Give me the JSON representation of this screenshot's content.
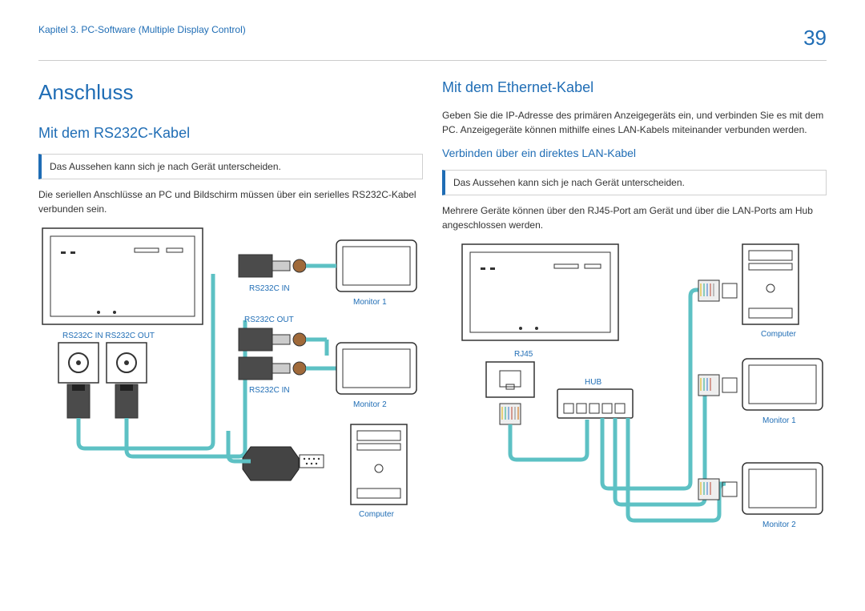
{
  "header": {
    "chapter": "Kapitel 3. PC-Software (Multiple Display Control)",
    "page": "39"
  },
  "left": {
    "title": "Anschluss",
    "h2": "Mit dem RS232C-Kabel",
    "note": "Das Aussehen kann sich je nach Gerät unterscheiden.",
    "para": "Die seriellen Anschlüsse an PC und Bildschirm müssen über ein serielles RS232C-Kabel verbunden sein.",
    "labels": {
      "rs232c_in_out": "RS232C IN RS232C OUT",
      "rs232c_in": "RS232C IN",
      "rs232c_out": "RS232C OUT",
      "monitor1": "Monitor 1",
      "monitor2": "Monitor 2",
      "computer": "Computer"
    }
  },
  "right": {
    "h2": "Mit dem Ethernet-Kabel",
    "para1": "Geben Sie die IP-Adresse des primären Anzeigegeräts ein, und verbinden Sie es mit dem PC. Anzeigegeräte können mithilfe eines LAN-Kabels miteinander verbunden werden.",
    "h3": "Verbinden über ein direktes LAN-Kabel",
    "note": "Das Aussehen kann sich je nach Gerät unterscheiden.",
    "para2": "Mehrere Geräte können über den RJ45-Port am Gerät und über die LAN-Ports am Hub angeschlossen werden.",
    "labels": {
      "rj45": "RJ45",
      "hub": "HUB",
      "computer": "Computer",
      "monitor1": "Monitor 1",
      "monitor2": "Monitor 2"
    }
  }
}
